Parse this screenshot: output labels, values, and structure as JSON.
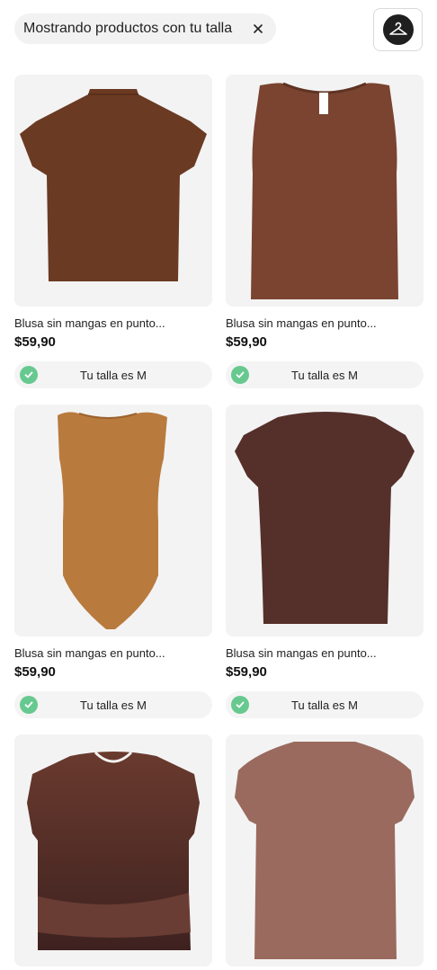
{
  "filter": {
    "label": "Mostrando productos con tu talla",
    "close_icon": "close-icon",
    "size_button_icon": "hanger-icon"
  },
  "products": [
    {
      "title": "Blusa sin mangas en punto...",
      "price": "$59,90",
      "size_label": "Tu talla es M",
      "color": "#6b3a22",
      "shape": "cap-tee"
    },
    {
      "title": "Blusa sin mangas en punto...",
      "price": "$59,90",
      "size_label": "Tu talla es M",
      "color": "#7a4430",
      "shape": "tank"
    },
    {
      "title": "Blusa sin mangas en punto...",
      "price": "$59,90",
      "size_label": "Tu talla es M",
      "color": "#b97a3e",
      "shape": "bodysuit"
    },
    {
      "title": "Blusa sin mangas en punto...",
      "price": "$59,90",
      "size_label": "Tu talla es M",
      "color": "#55302a",
      "shape": "cap-tee-long"
    },
    {
      "title": "",
      "price": "",
      "size_label": "",
      "color": "#5a3028",
      "shape": "crop-wrap"
    },
    {
      "title": "",
      "price": "",
      "size_label": "",
      "color": "#9a6a5e",
      "shape": "cap-tee-long"
    }
  ],
  "colors": {
    "check": "#67c98f",
    "chip_bg": "#f2f2f2",
    "image_bg": "#f3f3f3"
  }
}
